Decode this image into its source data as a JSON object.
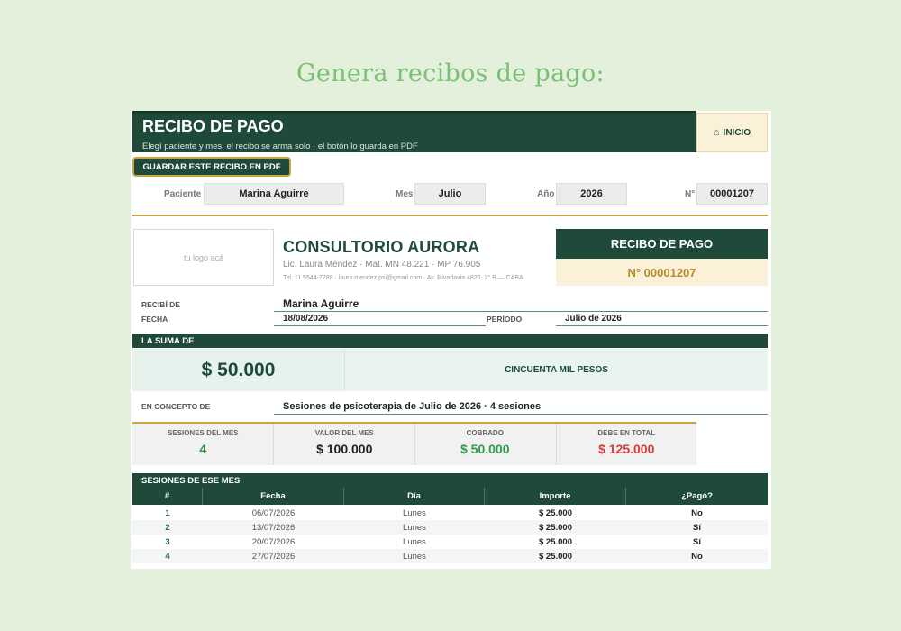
{
  "page": {
    "headline": "Genera recibos de pago:"
  },
  "header": {
    "title": "RECIBO DE PAGO",
    "subtitle": "Elegí paciente y mes: el recibo se arma solo · el botón lo guarda en PDF",
    "home_label": "INICIO",
    "save_label": "GUARDAR ESTE RECIBO EN PDF"
  },
  "selector": {
    "patient_label": "Paciente",
    "patient_value": "Marina Aguirre",
    "month_label": "Mes",
    "month_value": "Julio",
    "year_label": "Año",
    "year_value": "2026",
    "number_label": "N°",
    "number_value": "00001207"
  },
  "receipt": {
    "logo_placeholder": "tu logo acá",
    "clinic_name": "CONSULTORIO AURORA",
    "professional": "Lic. Laura Méndez   ·   Mat. MN 48.221 · MP 76.905",
    "contact": "Tel. 11 5544-7788   ·   laura.mendez.psi@gmail.com   ·   Av. Rivadavia 4820, 3° B — CABA",
    "box_title": "RECIBO DE PAGO",
    "box_number": "N°  00001207",
    "received_from_label": "RECIBÍ DE",
    "received_from_value": "Marina Aguirre",
    "date_label": "FECHA",
    "date_value": "18/08/2026",
    "period_label": "PERÍODO",
    "period_value": "Julio de 2026",
    "sum_label": "LA SUMA DE",
    "amount": "$ 50.000",
    "amount_words": "CINCUENTA MIL PESOS",
    "concept_label": "EN CONCEPTO DE",
    "concept_value": "Sesiones de psicoterapia de Julio de 2026 · 4 sesiones"
  },
  "summary": [
    {
      "label": "SESIONES DEL MES",
      "value": "4",
      "color": "#2e8b4e"
    },
    {
      "label": "VALOR DEL MES",
      "value": "$ 100.000",
      "color": "#222222"
    },
    {
      "label": "COBRADO",
      "value": "$ 50.000",
      "color": "#2e9b4e"
    },
    {
      "label": "DEBE EN TOTAL",
      "value": "$ 125.000",
      "color": "#d83a3a"
    }
  ],
  "sessions": {
    "title": "SESIONES DE ESE MES",
    "columns": [
      "#",
      "Fecha",
      "Día",
      "Importe",
      "¿Pagó?"
    ],
    "rows": [
      {
        "n": "1",
        "date": "06/07/2026",
        "day": "Lunes",
        "amount": "$ 25.000",
        "paid": "No"
      },
      {
        "n": "2",
        "date": "13/07/2026",
        "day": "Lunes",
        "amount": "$ 25.000",
        "paid": "Sí"
      },
      {
        "n": "3",
        "date": "20/07/2026",
        "day": "Lunes",
        "amount": "$ 25.000",
        "paid": "Sí"
      },
      {
        "n": "4",
        "date": "27/07/2026",
        "day": "Lunes",
        "amount": "$ 25.000",
        "paid": "No"
      }
    ]
  },
  "colors": {
    "primary": "#1f4a3a",
    "gold": "#c9a545",
    "cream": "#fbf0d8",
    "page_bg": "#e3f0dc"
  }
}
